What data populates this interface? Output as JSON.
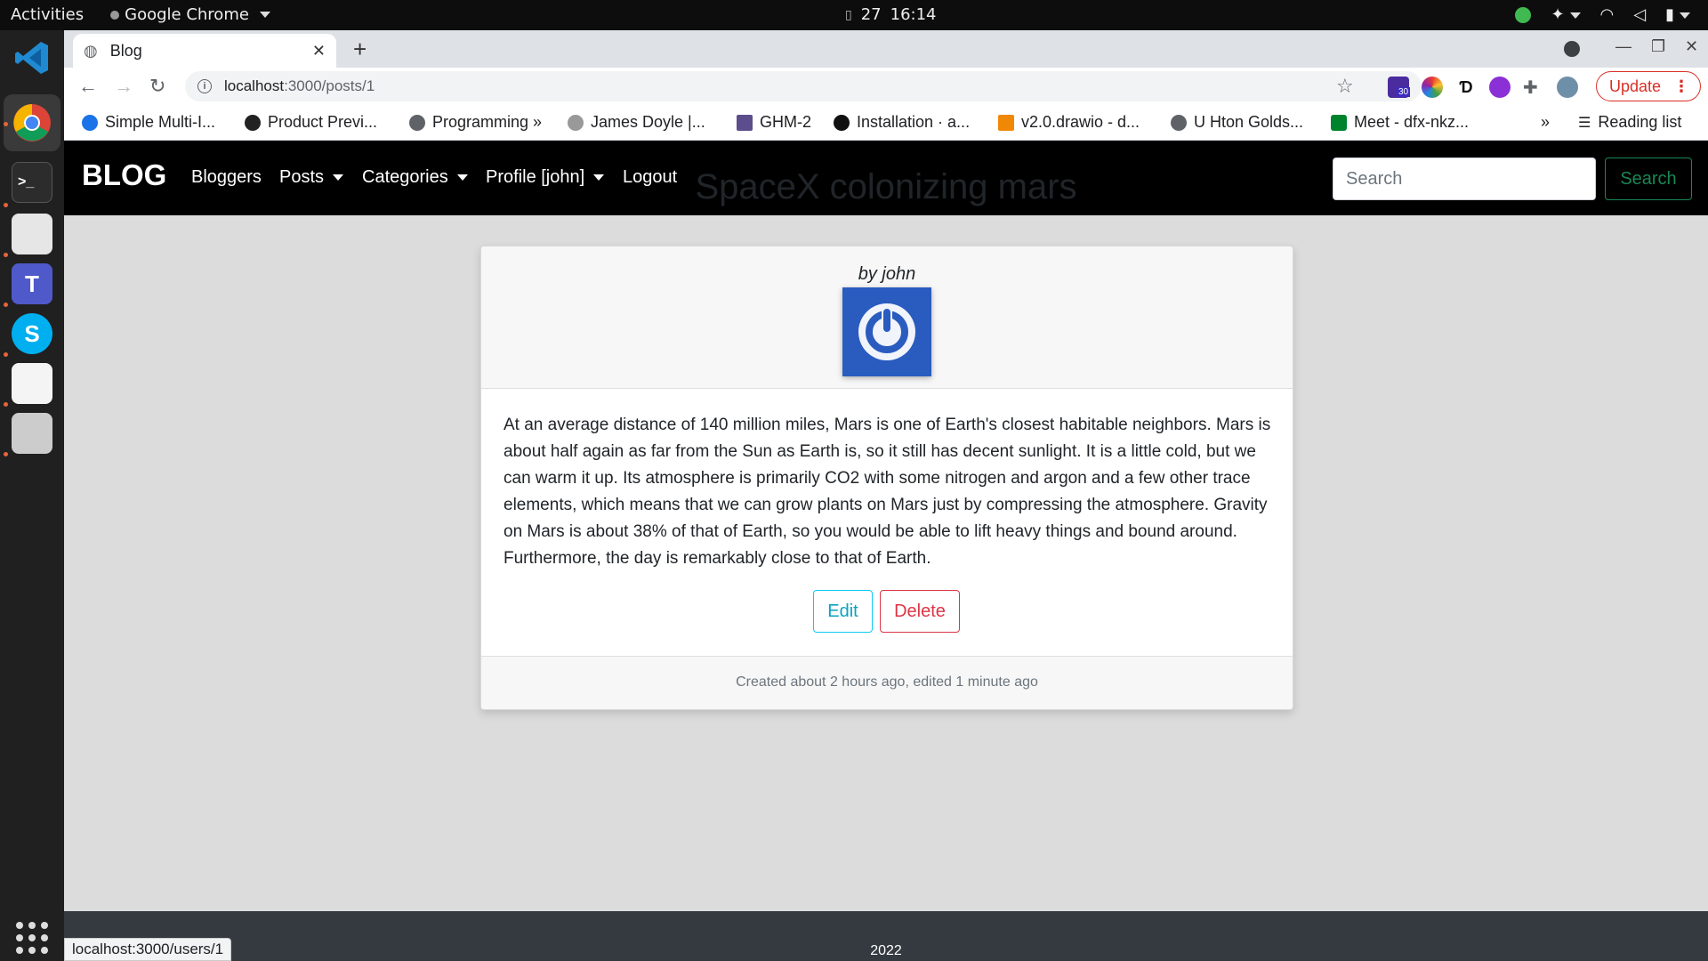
{
  "system_bar": {
    "activities": "Activities",
    "app_name": "Google Chrome",
    "date_day": "27",
    "time": "16:14"
  },
  "browser": {
    "tab_title": "Blog",
    "url_host": "localhost",
    "url_path": ":3000/posts/1",
    "update_label": "Update",
    "bookmarks": [
      {
        "label": "Simple Multi-I...",
        "color": "#1a73e8"
      },
      {
        "label": "Product Previ...",
        "color": "#222222"
      },
      {
        "label": "Programming »",
        "color": "#5f6368"
      },
      {
        "label": "James Doyle |...",
        "color": "#888888"
      },
      {
        "label": "GHM-2",
        "color": "#5c4e8c"
      },
      {
        "label": "Installation · a...",
        "color": "#111111"
      },
      {
        "label": "v2.0.drawio - d...",
        "color": "#f08705"
      },
      {
        "label": "U Hton Golds...",
        "color": "#5f6368"
      },
      {
        "label": "Meet - dfx-nkz...",
        "color": "#00832d"
      }
    ],
    "bookmarks_overflow": "»",
    "reading_list": "Reading list",
    "ext_badge": "30",
    "status_url": "localhost:3000/users/1"
  },
  "site": {
    "brand": "BLOG",
    "nav": {
      "bloggers": "Bloggers",
      "posts": "Posts",
      "categories": "Categories",
      "profile": "Profile [john]",
      "logout": "Logout"
    },
    "search": {
      "placeholder": "Search",
      "button": "Search"
    }
  },
  "post": {
    "title": "SpaceX colonizing mars",
    "byline": "by john",
    "body": "At an average distance of 140 million miles, Mars is one of Earth's closest habitable neighbors. Mars is about half again as far from the Sun as Earth is, so it still has decent sunlight. It is a little cold, but we can warm it up. Its atmosphere is primarily CO2 with some nitrogen and argon and a few other trace elements, which means that we can grow plants on Mars just by compressing the atmosphere. Gravity on Mars is about 38% of that of Earth, so you would be able to lift heavy things and bound around. Furthermore, the day is remarkably close to that of Earth.",
    "edit_label": "Edit",
    "delete_label": "Delete",
    "meta": "Created about 2 hours ago, edited 1 minute ago"
  },
  "footer": {
    "year": "2022"
  }
}
